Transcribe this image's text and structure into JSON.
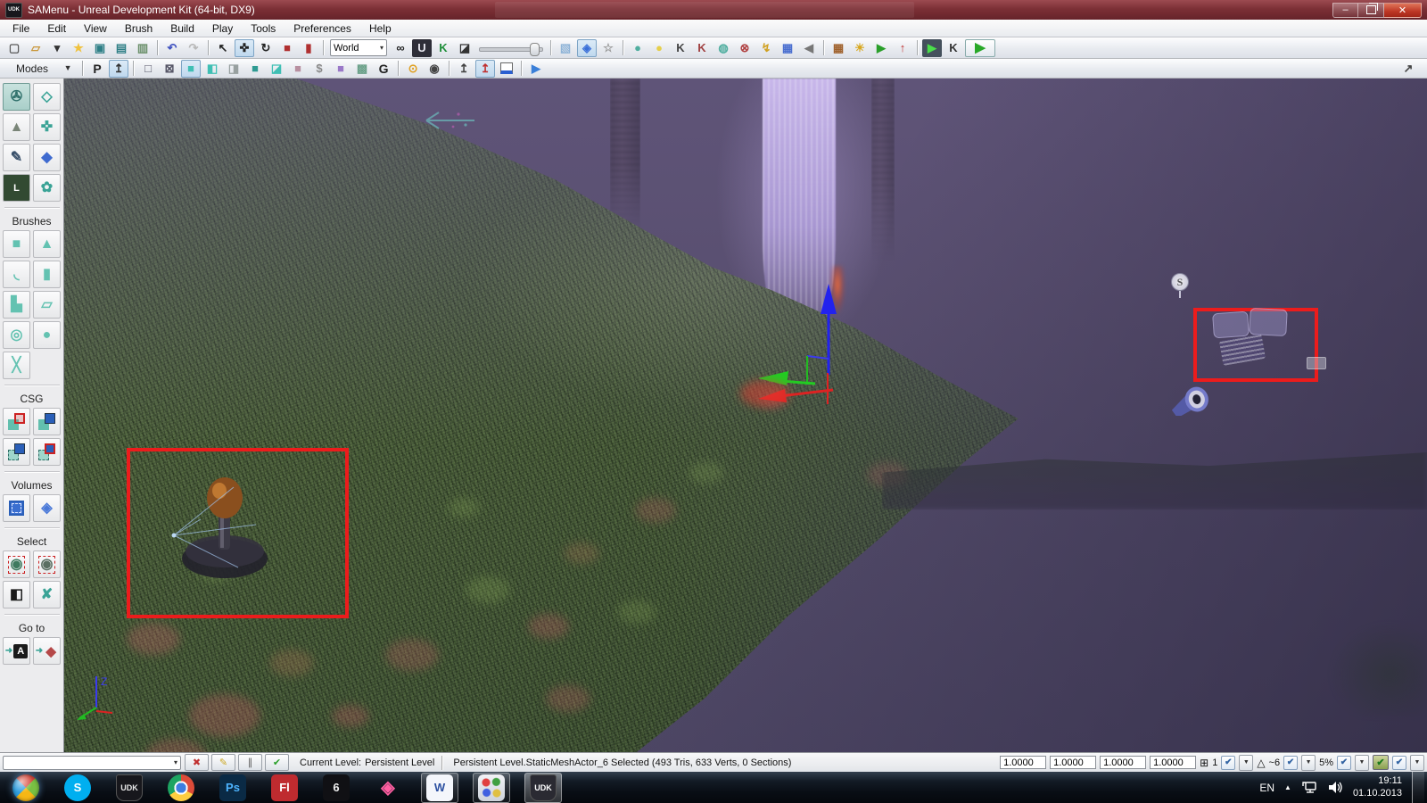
{
  "window": {
    "title": "SAMenu - Unreal Development Kit (64-bit, DX9)",
    "app_badge": "UDK",
    "minimize_glyph": "–",
    "close_glyph": "✕"
  },
  "menubar": {
    "items": [
      "File",
      "Edit",
      "View",
      "Brush",
      "Build",
      "Play",
      "Tools",
      "Preferences",
      "Help"
    ]
  },
  "toolbar_main": {
    "groups": [
      {
        "items": [
          {
            "name": "new-file-icon",
            "glyph": "▢",
            "fg": "#5a5a5a"
          },
          {
            "name": "open-folder-icon",
            "glyph": "▱",
            "fg": "#c9973a"
          },
          {
            "name": "open-dropdown-icon",
            "glyph": "▾",
            "fg": "#333333"
          },
          {
            "name": "favorites-star-icon",
            "glyph": "★",
            "fg": "#f0c23e"
          },
          {
            "name": "save-icon",
            "glyph": "▣",
            "fg": "#2e7f86"
          },
          {
            "name": "save-all-icon",
            "glyph": "▤",
            "fg": "#2e7f86"
          },
          {
            "name": "copy-package-icon",
            "glyph": "▥",
            "fg": "#6a8f6a"
          }
        ]
      },
      {
        "items": [
          {
            "name": "undo-icon",
            "glyph": "↶",
            "fg": "#3f51c0"
          },
          {
            "name": "redo-icon",
            "glyph": "↷",
            "fg": "#888888",
            "disabled": true
          }
        ]
      },
      {
        "items": [
          {
            "name": "select-tool-icon",
            "glyph": "↖",
            "fg": "#222222"
          },
          {
            "name": "translate-tool-icon",
            "glyph": "✜",
            "fg": "#222222",
            "pressed": true
          },
          {
            "name": "rotate-tool-icon",
            "glyph": "↻",
            "fg": "#222222"
          },
          {
            "name": "scale-tool-icon",
            "glyph": "■",
            "fg": "#b03030"
          },
          {
            "name": "scale-nonuniform-icon",
            "glyph": "▮",
            "fg": "#b03030"
          }
        ]
      },
      {
        "items": [
          {
            "name": "coordinate-system-select",
            "type": "combo",
            "label": "World"
          },
          {
            "name": "search-binoculars-icon",
            "glyph": "∞",
            "fg": "#222222"
          },
          {
            "name": "content-browser-icon",
            "glyph": "U",
            "fg": "#e8e8f0",
            "bg": "#2e2e38"
          },
          {
            "name": "kismet-icon",
            "glyph": "K",
            "fg": "#1f8f3a"
          },
          {
            "name": "matinee-icon",
            "glyph": "◪",
            "fg": "#333333"
          },
          {
            "name": "camera-speed-slider",
            "type": "slider"
          }
        ]
      },
      {
        "items": [
          {
            "name": "translucent-cube-icon",
            "glyph": "▧",
            "fg": "#8fb4d8"
          },
          {
            "name": "selection-cube-icon",
            "glyph": "◈",
            "fg": "#3a6fd8",
            "pressed": true
          },
          {
            "name": "star-outline-icon",
            "glyph": "☆",
            "fg": "#999999"
          }
        ]
      },
      {
        "items": [
          {
            "name": "socket-sphere-icon",
            "glyph": "●",
            "fg": "#4fae9f"
          },
          {
            "name": "light-bulb-icon",
            "glyph": "●",
            "fg": "#e6cf4a"
          },
          {
            "name": "kismet-find-icon",
            "glyph": "K",
            "fg": "#444444"
          },
          {
            "name": "kismet-ref-icon",
            "glyph": "K",
            "fg": "#a04040"
          },
          {
            "name": "speech-sphere-icon",
            "glyph": "◍",
            "fg": "#4fae9f"
          },
          {
            "name": "no-collision-icon",
            "glyph": "⊗",
            "fg": "#b04040"
          },
          {
            "name": "decal-arrow-icon",
            "glyph": "↯",
            "fg": "#d0a020"
          },
          {
            "name": "grid-panel-icon",
            "glyph": "▦",
            "fg": "#4a6fd0"
          },
          {
            "name": "sound-speaker-icon",
            "glyph": "◀",
            "fg": "#777777"
          }
        ]
      },
      {
        "items": [
          {
            "name": "build-geometry-icon",
            "glyph": "▦",
            "fg": "#a0622d"
          },
          {
            "name": "build-lighting-icon",
            "glyph": "☀",
            "fg": "#d8a820"
          },
          {
            "name": "build-paths-icon",
            "glyph": "▶",
            "fg": "#2a9f2a"
          },
          {
            "name": "build-all-icon",
            "glyph": "↑",
            "fg": "#c03030"
          }
        ]
      },
      {
        "items": [
          {
            "name": "play-in-viewport-icon",
            "glyph": "▶",
            "fg": "#4adf4a",
            "bg": "#44505c"
          },
          {
            "name": "kismet-debug-icon",
            "glyph": "K",
            "fg": "#333333"
          },
          {
            "name": "play-level-button",
            "glyph": "▶",
            "fg": "#28a828",
            "big": true
          }
        ]
      }
    ]
  },
  "toolbar_secondary": {
    "modes_label": "Modes",
    "items": [
      {
        "name": "letter-p-button",
        "glyph": "P",
        "fg": "#222222",
        "letter": true
      },
      {
        "name": "brush-widget-icon",
        "glyph": "↥",
        "fg": "#333333",
        "pressed": true
      },
      {
        "type": "sep"
      },
      {
        "name": "wire-cube-icon",
        "glyph": "□",
        "fg": "#555566"
      },
      {
        "name": "wire-cube-x-icon",
        "glyph": "⊠",
        "fg": "#555566"
      },
      {
        "name": "solid-cube-icon",
        "glyph": "■",
        "fg": "#3fbfb4",
        "pressed": true
      },
      {
        "name": "cube-left-icon",
        "glyph": "◧",
        "fg": "#3fbfb4"
      },
      {
        "name": "cube-right-icon",
        "glyph": "◨",
        "fg": "#98a0a0"
      },
      {
        "name": "cube-dark-icon",
        "glyph": "■",
        "fg": "#2e9a92"
      },
      {
        "name": "cube-corner-icon",
        "glyph": "◪",
        "fg": "#3fbfb4"
      },
      {
        "name": "cube-mauve-icon",
        "glyph": "■",
        "fg": "#b890a0"
      },
      {
        "name": "cube-dollar-icon",
        "glyph": "$",
        "fg": "#888888"
      },
      {
        "name": "cube-purple-icon",
        "glyph": "■",
        "fg": "#9a78c8"
      },
      {
        "name": "cube-textured-icon",
        "glyph": "▩",
        "fg": "#6aa089"
      },
      {
        "name": "letter-g-button",
        "glyph": "G",
        "fg": "#222222",
        "letter": true
      },
      {
        "type": "sep"
      },
      {
        "name": "lock-icon",
        "glyph": "⊙",
        "fg": "#e0a020"
      },
      {
        "name": "eye-icon",
        "glyph": "◉",
        "fg": "#444444"
      },
      {
        "type": "sep"
      },
      {
        "name": "widget-toggle-icon",
        "glyph": "↥",
        "fg": "#444444"
      },
      {
        "name": "widget-red-icon",
        "glyph": "↥",
        "fg": "#c03030",
        "pressed": true
      },
      {
        "name": "brush-swatch-icon",
        "type": "swatch"
      },
      {
        "type": "sep"
      },
      {
        "name": "play-blue-icon",
        "glyph": "▶",
        "fg": "#3a7fd8"
      },
      {
        "name": "redock-window-icon",
        "glyph": "↗",
        "fg": "#444444",
        "right": true
      }
    ]
  },
  "sidebar": {
    "sections": [
      {
        "title": "",
        "items": [
          {
            "name": "camera-mode-icon",
            "glyph": "✇",
            "fg": "#2e6f6a",
            "pressed": true
          },
          {
            "name": "geometry-mode-icon",
            "glyph": "◇",
            "fg": "#3aa396"
          },
          {
            "name": "terrain-mode-icon",
            "glyph": "▲",
            "fg": "#7a8578"
          },
          {
            "name": "texture-align-icon",
            "glyph": "✜",
            "fg": "#3aa396"
          },
          {
            "name": "geometry-edit-icon",
            "glyph": "✎",
            "fg": "#39506a"
          },
          {
            "name": "static-mesh-mode-icon",
            "glyph": "◆",
            "fg": "#3f6bd0"
          },
          {
            "name": "landscape-mode-icon",
            "type": "letterbox",
            "glyph": "L",
            "bg": "#324a32"
          },
          {
            "name": "foliage-mode-icon",
            "glyph": "✿",
            "fg": "#3aa396"
          }
        ]
      },
      {
        "title": "Brushes",
        "items": [
          {
            "name": "brush-cube-icon",
            "glyph": "■",
            "fg": "#63c2b1"
          },
          {
            "name": "brush-cone-icon",
            "glyph": "▲",
            "fg": "#63c2b1"
          },
          {
            "name": "brush-curved-stair-icon",
            "glyph": "◟",
            "fg": "#63c2b1"
          },
          {
            "name": "brush-cylinder-icon",
            "glyph": "▮",
            "fg": "#63c2b1"
          },
          {
            "name": "brush-stair-icon",
            "glyph": "▙",
            "fg": "#63c2b1"
          },
          {
            "name": "brush-sheet-icon",
            "glyph": "▱",
            "fg": "#63c2b1"
          },
          {
            "name": "brush-spiral-stair-icon",
            "glyph": "◎",
            "fg": "#63c2b1"
          },
          {
            "name": "brush-sphere-icon",
            "glyph": "●",
            "fg": "#63c2b1"
          },
          {
            "name": "brush-volumetric-icon",
            "glyph": "╳",
            "fg": "#63c2b1"
          }
        ]
      },
      {
        "title": "CSG",
        "items": [
          {
            "name": "csg-add-icon",
            "type": "csg",
            "back": {
              "color": "#62bfae"
            },
            "front": {
              "border": "#cc2222",
              "color": "rgba(200,60,60,.25)"
            }
          },
          {
            "name": "csg-subtract-icon",
            "type": "csg",
            "back": {
              "color": "#62bfae"
            },
            "front": {
              "color": "#2a5fb8"
            }
          },
          {
            "name": "csg-intersect-icon",
            "type": "csg",
            "back": {
              "color": "#9fd6cb",
              "dashed": true
            },
            "front": {
              "color": "#2a5fb8"
            }
          },
          {
            "name": "csg-deintersect-icon",
            "type": "csg",
            "back": {
              "color": "#9fd6cb",
              "dashed": true
            },
            "front": {
              "color": "#2a5fb8",
              "border": "#cc2222"
            }
          }
        ]
      },
      {
        "title": "Volumes",
        "items": [
          {
            "name": "volume-brush-icon",
            "type": "volsq"
          },
          {
            "name": "blocking-volume-icon",
            "glyph": "◈",
            "fg": "#4a79d8"
          }
        ]
      },
      {
        "title": "Select",
        "items": [
          {
            "name": "show-selected-icon",
            "glyph": "◉",
            "fg": "#3f7a5f",
            "reddash": true
          },
          {
            "name": "hide-selected-icon",
            "glyph": "◉",
            "fg": "#5a6f62",
            "reddash": true
          },
          {
            "name": "invert-selection-icon",
            "glyph": "◧",
            "fg": "#1a1a1a"
          },
          {
            "name": "select-none-icon",
            "glyph": "✘",
            "fg": "#3aa396"
          }
        ]
      },
      {
        "title": "Go to",
        "items": [
          {
            "name": "goto-actor-icon",
            "type": "goto",
            "target": "A",
            "tbg": "#1a1a1a",
            "tfg": "#ffffff"
          },
          {
            "name": "goto-builder-icon",
            "type": "goto",
            "target": "◆",
            "tbg": "transparent",
            "tfg": "#b54848"
          }
        ]
      }
    ]
  },
  "viewport": {
    "axis_z_label": "Z",
    "sound_sprite_letter": "S"
  },
  "statusbar": {
    "combo_arrow": "▾",
    "buttons": [
      {
        "name": "red-cross-button",
        "glyph": "✖",
        "fg": "#c03030"
      },
      {
        "name": "brush-paint-button",
        "glyph": "✎",
        "fg": "#caa520"
      },
      {
        "name": "divider-button",
        "glyph": "∥",
        "fg": "#555555"
      },
      {
        "name": "camera-check-button",
        "glyph": "✔",
        "fg": "#2a9f2a"
      }
    ],
    "current_level_label": "Current Level:",
    "current_level_value": "Persistent Level",
    "selection_info": "Persistent Level.StaticMeshActor_6 Selected (493 Tris, 633 Verts, 0 Sections)",
    "fields": [
      "1.0000",
      "1.0000",
      "1.0000",
      "1.0000"
    ],
    "drag_grid_icon": "⊞",
    "drag_grid_value": "1",
    "rotation_grid_icon": "△",
    "rotation_grid_value": "~6",
    "scale_snap_value": "5%",
    "check_glyph": "✔",
    "dd_glyph": "▼"
  },
  "taskbar": {
    "icons": [
      {
        "name": "start-button",
        "kind": "orb"
      },
      {
        "name": "taskbar-skype",
        "kind": "circle",
        "label": "S",
        "bg": "#00aff0",
        "fg": "#ffffff"
      },
      {
        "name": "taskbar-udk",
        "kind": "shield",
        "label": "UDK",
        "bg": "#17171c",
        "fg": "#e8e8e8"
      },
      {
        "name": "taskbar-chrome",
        "kind": "chrome"
      },
      {
        "name": "taskbar-photoshop",
        "kind": "square",
        "label": "Ps",
        "bg": "#0a2a45",
        "fg": "#4db4ff"
      },
      {
        "name": "taskbar-flash",
        "kind": "square",
        "label": "Fl",
        "bg": "#bf2b2f",
        "fg": "#ffffff"
      },
      {
        "name": "taskbar-spiral-app",
        "kind": "square",
        "label": "6",
        "bg": "#101014",
        "fg": "#eeeeee"
      },
      {
        "name": "taskbar-3d-app",
        "kind": "wire",
        "label": "◈",
        "bg": "transparent",
        "fg": "#ff5fa2"
      },
      {
        "name": "taskbar-word",
        "kind": "square",
        "label": "W",
        "bg": "#f4f6fb",
        "fg": "#2b4fa0",
        "open": true
      },
      {
        "name": "taskbar-image-editor",
        "kind": "palette",
        "open": true
      },
      {
        "name": "taskbar-udk-active",
        "kind": "shield",
        "label": "UDK",
        "bg": "#2a2a32",
        "fg": "#ffffff",
        "open": true,
        "active": true
      }
    ],
    "tray": {
      "language": "EN",
      "hidden_icons_glyph": "▲",
      "time": "19:11",
      "date": "01.10.2013"
    }
  }
}
